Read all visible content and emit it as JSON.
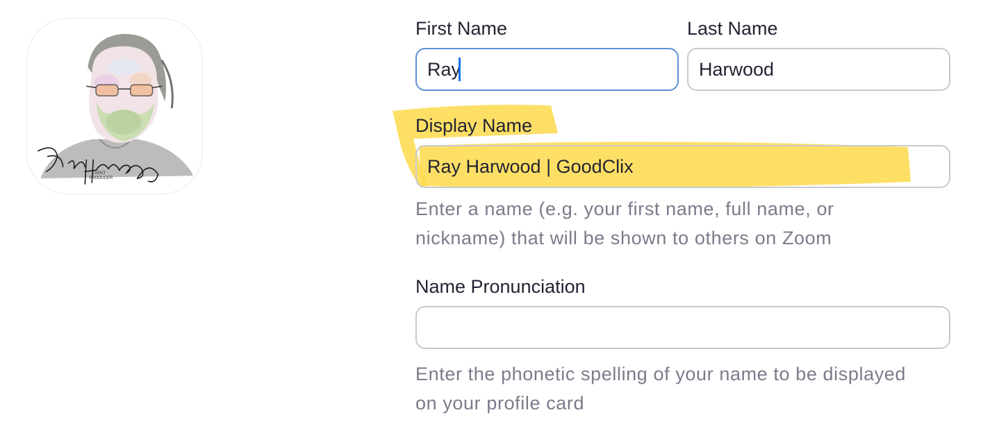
{
  "avatar": {
    "alt": "Ray Harwood profile picture",
    "signature": "Ray Harwood",
    "caption": "EVENT PRODUCER"
  },
  "form": {
    "first_name": {
      "label": "First Name",
      "value": "Ray"
    },
    "last_name": {
      "label": "Last Name",
      "value": "Harwood"
    },
    "display_name": {
      "label": "Display Name",
      "value": "Ray Harwood | GoodClix",
      "hint_line1": "Enter a name (e.g. your first name, full name, or",
      "hint_line2": "nickname) that will be shown to others on Zoom"
    },
    "pronunciation": {
      "label": "Name Pronunciation",
      "value": "",
      "hint_line1": "Enter the phonetic spelling of your name to be displayed",
      "hint_line2": "on your profile card"
    }
  },
  "colors": {
    "highlight": "#fdd94a",
    "focus_border": "#5a8fd6",
    "caret": "#0e72ed"
  }
}
